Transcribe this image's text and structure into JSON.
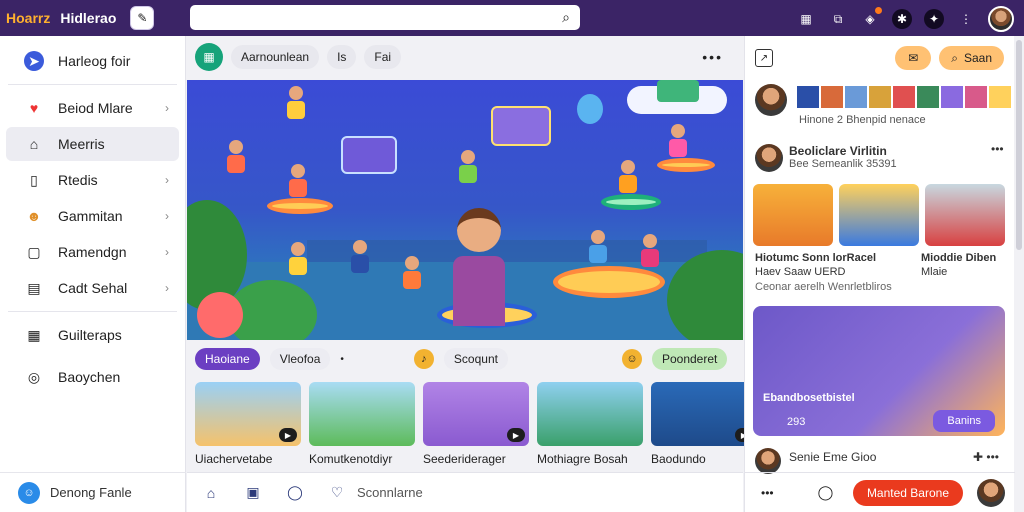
{
  "header": {
    "logo_text": "Hoarrz",
    "brand": "Hidlerao",
    "search_placeholder": ""
  },
  "sidebar": {
    "top_item": "Harleog foir",
    "items": [
      {
        "label": "Beiod Mlare",
        "icon": "heart-icon"
      },
      {
        "label": "Meerris",
        "icon": "home-icon"
      },
      {
        "label": "Rtedis",
        "icon": "book-icon"
      },
      {
        "label": "Gammitan",
        "icon": "emoji-icon"
      },
      {
        "label": "Ramendgn",
        "icon": "box-icon"
      },
      {
        "label": "Cadt Sehal",
        "icon": "clipboard-icon"
      }
    ],
    "items2": [
      {
        "label": "Guilteraps",
        "icon": "grid-icon"
      },
      {
        "label": "Baoychen",
        "icon": "target-icon"
      }
    ],
    "footer": "Denong Fanle"
  },
  "main": {
    "chips": [
      "Aarnounlean",
      "Is",
      "Fai"
    ],
    "subtabs": [
      "Haoiane",
      "Vleofoa",
      "Scoqunt",
      "Poonderet"
    ],
    "cards": [
      "Uiachervetabe",
      "Komutkenotdiyr",
      "Seederiderager",
      "Mothiagre Bosah",
      "Baodundo"
    ],
    "bottom_label": "Sconnlarne"
  },
  "right": {
    "save_label": "Saan",
    "strip_caption": "Hinone 2 Bhenpid nenace",
    "post_title": "Beoliclare Virlitin",
    "post_meta": "Bee Semeanlik  35391",
    "feed_captions": [
      "Hiotumc Sonn lorRacel",
      "Haev Saaw UERD",
      "Mioddie Diben",
      "Mlaie"
    ],
    "feed_sub": "Ceonar aerelh Wenrletbliros",
    "big_card_title": "Ebandbosetbistel",
    "big_card_count": "293",
    "big_card_button": "Banins",
    "bottom_user": "Senie Eme Gioo",
    "cta": "Manted Barone"
  },
  "colors": {
    "accent": "#6b3fc2",
    "topbar": "#3b2466",
    "cta": "#ea3a1e"
  }
}
